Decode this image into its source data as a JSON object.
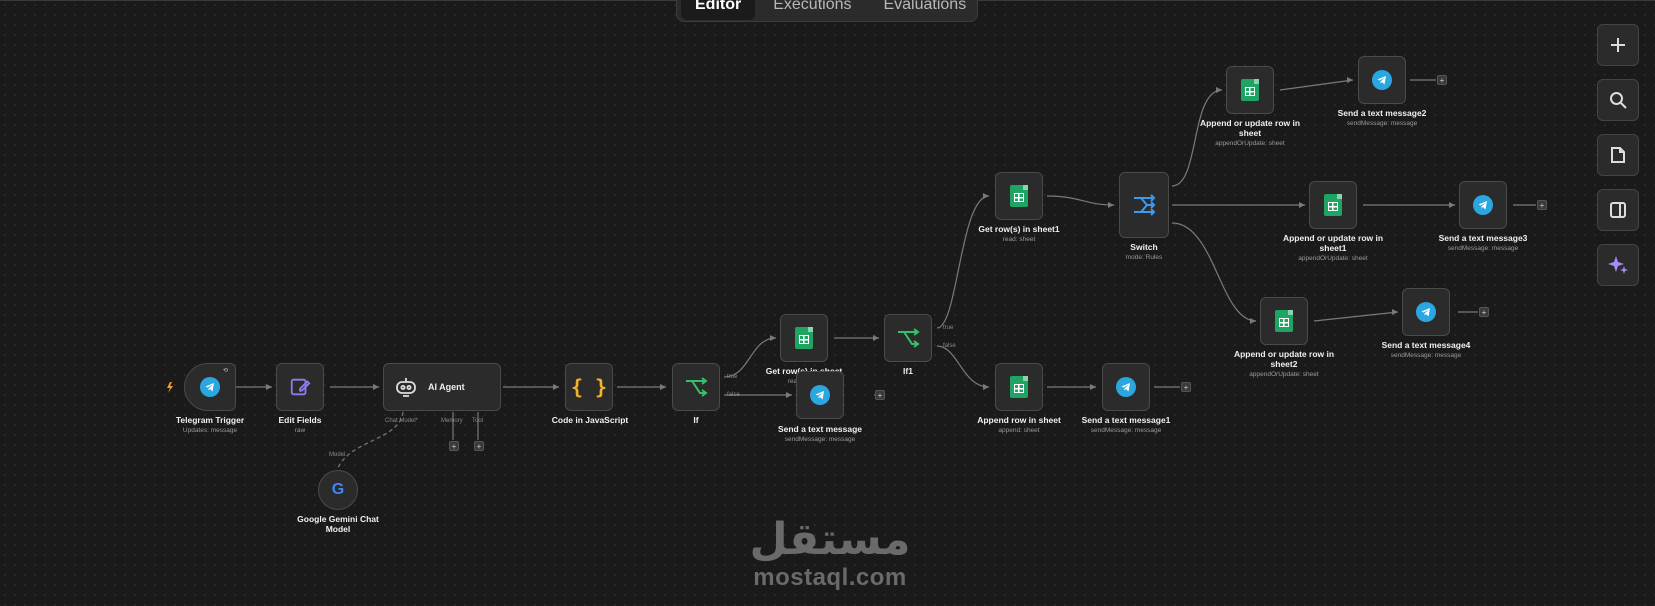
{
  "tabs": {
    "editor": "Editor",
    "executions": "Executions",
    "evaluations": "Evaluations"
  },
  "nodes": {
    "telegram_trigger": {
      "title": "Telegram Trigger",
      "sub": "Updates: message"
    },
    "edit_fields": {
      "title": "Edit Fields",
      "sub": "raw"
    },
    "ai_agent": {
      "title": "AI Agent",
      "chat_model": "Chat Model*",
      "memory": "Memory",
      "tool": "Tool"
    },
    "gemini": {
      "title": "Google Gemini Chat Model",
      "port": "Model"
    },
    "code": {
      "title": "Code in JavaScript"
    },
    "if": {
      "title": "If",
      "true": "true",
      "false": "false"
    },
    "get_rows": {
      "title": "Get row(s) in sheet",
      "sub": "read: sheet"
    },
    "send_msg": {
      "title": "Send a text message",
      "sub": "sendMessage: message"
    },
    "if1": {
      "title": "If1",
      "true": "true",
      "false": "false"
    },
    "get_rows1": {
      "title": "Get row(s) in sheet1",
      "sub": "read: sheet"
    },
    "append_row": {
      "title": "Append row in sheet",
      "sub": "append: sheet"
    },
    "send_msg1": {
      "title": "Send a text message1",
      "sub": "sendMessage: message"
    },
    "switch": {
      "title": "Switch",
      "sub": "mode: Rules"
    },
    "append_update": {
      "title": "Append or update row in sheet",
      "sub": "appendOrUpdate: sheet"
    },
    "send_msg2": {
      "title": "Send a text message2",
      "sub": "sendMessage: message"
    },
    "append_update1": {
      "title": "Append or update row in sheet1",
      "sub": "appendOrUpdate: sheet"
    },
    "send_msg3": {
      "title": "Send a text message3",
      "sub": "sendMessage: message"
    },
    "append_update2": {
      "title": "Append or update row in sheet2",
      "sub": "appendOrUpdate: sheet"
    },
    "send_msg4": {
      "title": "Send a text message4",
      "sub": "sendMessage: message"
    }
  },
  "plus_symbol": "+",
  "toolbar_icons": [
    "plus-icon",
    "search-icon",
    "sticky-note-icon",
    "panel-icon",
    "sparkle-icon"
  ],
  "watermark": {
    "arabic": "مستقل",
    "latin": "mostaql.com"
  },
  "colors": {
    "sheets": "#20a464",
    "telegram": "#2aa6e0",
    "if_green": "#35c06a",
    "switch_blue": "#3b9bf0",
    "code_yellow": "#f0b429",
    "edit_purple": "#8b7cf0",
    "sparkle": "#a78bfa"
  }
}
